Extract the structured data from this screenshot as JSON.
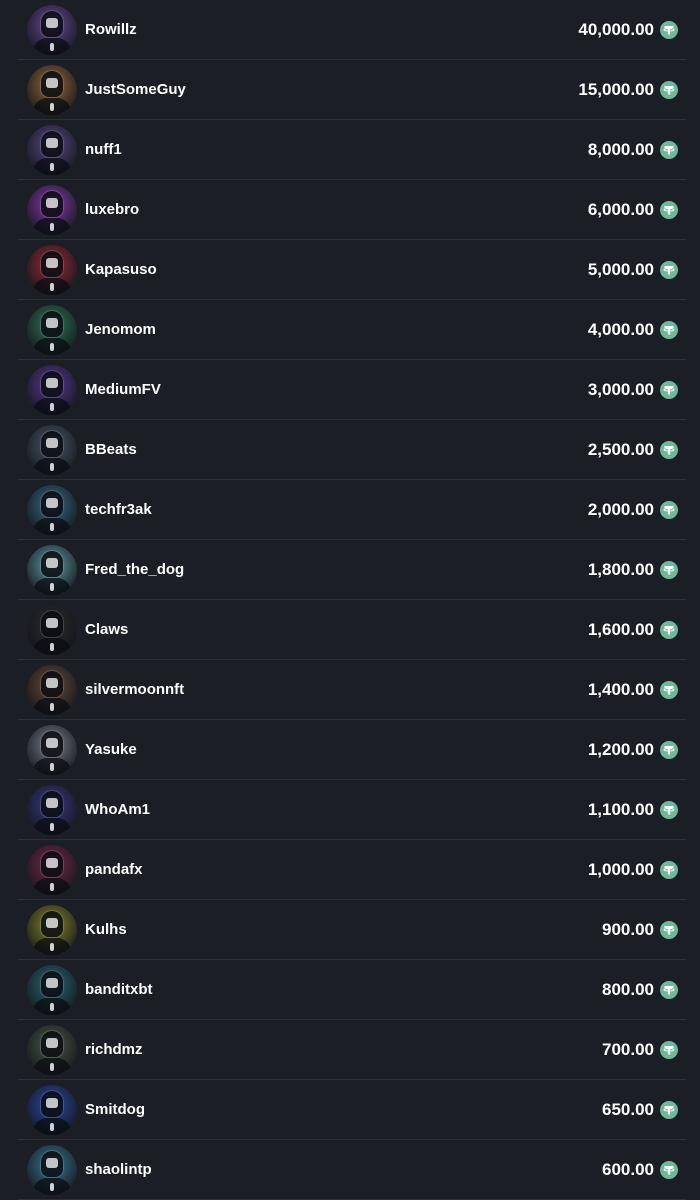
{
  "currency_icon": "tether-usdt-icon",
  "colors": {
    "background": "#1b1e24",
    "divider": "#2a2e36",
    "token": "#6fb99a",
    "text": "#ffffff"
  },
  "leaderboard": [
    {
      "name": "Rowillz",
      "amount": "40,000.00",
      "avatar_icon": "robot-avatar-icon",
      "avatar_color": "#6a4a9c"
    },
    {
      "name": "JustSomeGuy",
      "amount": "15,000.00",
      "avatar_icon": "robot-avatar-icon",
      "avatar_color": "#9a6a3a"
    },
    {
      "name": "nuff1",
      "amount": "8,000.00",
      "avatar_icon": "robot-avatar-icon",
      "avatar_color": "#5b4a8a"
    },
    {
      "name": "luxebro",
      "amount": "6,000.00",
      "avatar_icon": "robot-avatar-icon",
      "avatar_color": "#8a3ab0"
    },
    {
      "name": "Kapasuso",
      "amount": "5,000.00",
      "avatar_icon": "robot-avatar-icon",
      "avatar_color": "#9a2a3a"
    },
    {
      "name": "Jenomom",
      "amount": "4,000.00",
      "avatar_icon": "robot-avatar-icon",
      "avatar_color": "#2f7a5a"
    },
    {
      "name": "MediumFV",
      "amount": "3,000.00",
      "avatar_icon": "robot-avatar-icon",
      "avatar_color": "#5a3a9a"
    },
    {
      "name": "BBeats",
      "amount": "2,500.00",
      "avatar_icon": "robot-avatar-icon",
      "avatar_color": "#4a5a6a"
    },
    {
      "name": "techfr3ak",
      "amount": "2,000.00",
      "avatar_icon": "robot-avatar-icon",
      "avatar_color": "#3a6a8a"
    },
    {
      "name": "Fred_the_dog",
      "amount": "1,800.00",
      "avatar_icon": "robot-avatar-icon",
      "avatar_color": "#5fa0a8"
    },
    {
      "name": "Claws",
      "amount": "1,600.00",
      "avatar_icon": "robot-avatar-icon",
      "avatar_color": "#2a2a2a"
    },
    {
      "name": "silvermoonnft",
      "amount": "1,400.00",
      "avatar_icon": "robot-avatar-icon",
      "avatar_color": "#6a4a3a"
    },
    {
      "name": "Yasuke",
      "amount": "1,200.00",
      "avatar_icon": "robot-avatar-icon",
      "avatar_color": "#7a7f8a"
    },
    {
      "name": "WhoAm1",
      "amount": "1,100.00",
      "avatar_icon": "robot-avatar-icon",
      "avatar_color": "#3a3a8a"
    },
    {
      "name": "pandafx",
      "amount": "1,000.00",
      "avatar_icon": "robot-avatar-icon",
      "avatar_color": "#7a2a4a"
    },
    {
      "name": "Kulhs",
      "amount": "900.00",
      "avatar_icon": "robot-avatar-icon",
      "avatar_color": "#8a8a2a"
    },
    {
      "name": "banditxbt",
      "amount": "800.00",
      "avatar_icon": "robot-avatar-icon",
      "avatar_color": "#2a6a7a"
    },
    {
      "name": "richdmz",
      "amount": "700.00",
      "avatar_icon": "robot-avatar-icon",
      "avatar_color": "#4a5a4a"
    },
    {
      "name": "Smitdog",
      "amount": "650.00",
      "avatar_icon": "robot-avatar-icon",
      "avatar_color": "#2a4aaa"
    },
    {
      "name": "shaolintp",
      "amount": "600.00",
      "avatar_icon": "robot-avatar-icon",
      "avatar_color": "#3a7a9a"
    }
  ]
}
